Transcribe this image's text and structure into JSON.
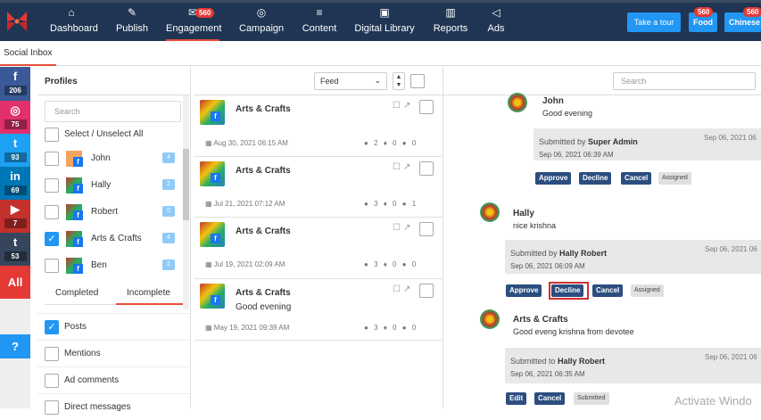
{
  "nav": {
    "items": [
      {
        "label": "Dashboard",
        "icon": "home-icon"
      },
      {
        "label": "Publish",
        "icon": "edit-icon"
      },
      {
        "label": "Engagement",
        "icon": "inbox-icon",
        "badge": "560"
      },
      {
        "label": "Campaign",
        "icon": "target-icon"
      },
      {
        "label": "Content",
        "icon": "list-icon"
      },
      {
        "label": "Digital Library",
        "icon": "briefcase-icon"
      },
      {
        "label": "Reports",
        "icon": "chart-icon"
      },
      {
        "label": "Ads",
        "icon": "megaphone-icon"
      }
    ],
    "tour_label": "Take a tour",
    "workspaces": [
      {
        "label": "Food",
        "badge": "560"
      },
      {
        "label": "Chinese",
        "badge": "560"
      }
    ]
  },
  "subbar": {
    "title": "Social Inbox"
  },
  "social": [
    {
      "glyph": "f",
      "count": "206",
      "color": "#3b5998",
      "icon": "facebook-icon"
    },
    {
      "glyph": "◎",
      "count": "75",
      "color": "#e1306c",
      "icon": "instagram-icon"
    },
    {
      "glyph": "t",
      "count": "93",
      "color": "#1da1f2",
      "icon": "twitter-icon"
    },
    {
      "glyph": "in",
      "count": "69",
      "color": "#0077b5",
      "icon": "linkedin-icon"
    },
    {
      "glyph": "▶",
      "count": "7",
      "color": "#c4302b",
      "icon": "youtube-icon"
    },
    {
      "glyph": "t",
      "count": "53",
      "color": "#35465c",
      "icon": "tumblr-icon"
    },
    {
      "glyph": "All",
      "count": "",
      "color": "#e53935",
      "icon": "all-icon"
    },
    {
      "glyph": "?",
      "count": "",
      "color": "#2196f3",
      "icon": "help-icon"
    }
  ],
  "profiles": {
    "header": "Profiles",
    "search_placeholder": "Search",
    "select_all": "Select / Unselect All",
    "items": [
      {
        "name": "John",
        "count": "4",
        "checked": false
      },
      {
        "name": "Hally",
        "count": "2",
        "checked": false
      },
      {
        "name": "Robert",
        "count": "0",
        "checked": false
      },
      {
        "name": "Arts & Crafts",
        "count": "4",
        "checked": true
      },
      {
        "name": "Ben",
        "count": "2",
        "checked": false
      }
    ],
    "tabs": [
      "Completed",
      "Incomplete"
    ],
    "filters": [
      {
        "label": "Posts",
        "checked": true
      },
      {
        "label": "Mentions",
        "checked": false
      },
      {
        "label": "Ad comments",
        "checked": false
      },
      {
        "label": "Direct messages",
        "checked": false
      }
    ]
  },
  "feed": {
    "select_value": "Feed",
    "posts": [
      {
        "name": "Arts & Crafts",
        "message": "",
        "date": "Aug 30, 2021 06:15 AM",
        "comments": "2",
        "likes": "0",
        "tags": "0"
      },
      {
        "name": "Arts & Crafts",
        "message": "",
        "date": "Jul 21, 2021 07:12 AM",
        "comments": "3",
        "likes": "0",
        "tags": "1"
      },
      {
        "name": "Arts & Crafts",
        "message": "",
        "date": "Jul 19, 2021 02:09 AM",
        "comments": "3",
        "likes": "0",
        "tags": "0"
      },
      {
        "name": "Arts & Crafts",
        "message": "Good evening",
        "date": "May 19, 2021 09:39 AM",
        "comments": "3",
        "likes": "0",
        "tags": "0"
      }
    ]
  },
  "detail": {
    "search_placeholder": "Search",
    "comments": [
      {
        "name": "John",
        "text": "Good evening",
        "submit_prefix": "Submitted by",
        "submitter": "Super Admin",
        "submit_time": "Sep 06, 2021 06:39 AM",
        "date_right": "Sep 06, 2021 06",
        "buttons": [
          "Approve",
          "Decline",
          "Cancel"
        ],
        "status": "Assigned"
      },
      {
        "name": "Hally",
        "text": "nice krishna",
        "submit_prefix": "Submitted by",
        "submitter": "Hally Robert",
        "submit_time": "Sep 06, 2021 06:09 AM",
        "date_right": "Sep 06, 2021 06",
        "buttons": [
          "Approve",
          "Decline",
          "Cancel"
        ],
        "status": "Assigned"
      },
      {
        "name": "Arts & Crafts",
        "text": "Good eveng krishna from devotee",
        "submit_prefix": "Submitted to",
        "submitter": "Hally Robert",
        "submit_time": "Sep 06, 2021 06:35 AM",
        "date_right": "Sep 06, 2021 06",
        "buttons": [
          "Edit",
          "Cancel"
        ],
        "status": "Submitted"
      }
    ],
    "watermark": "Activate Windo"
  }
}
